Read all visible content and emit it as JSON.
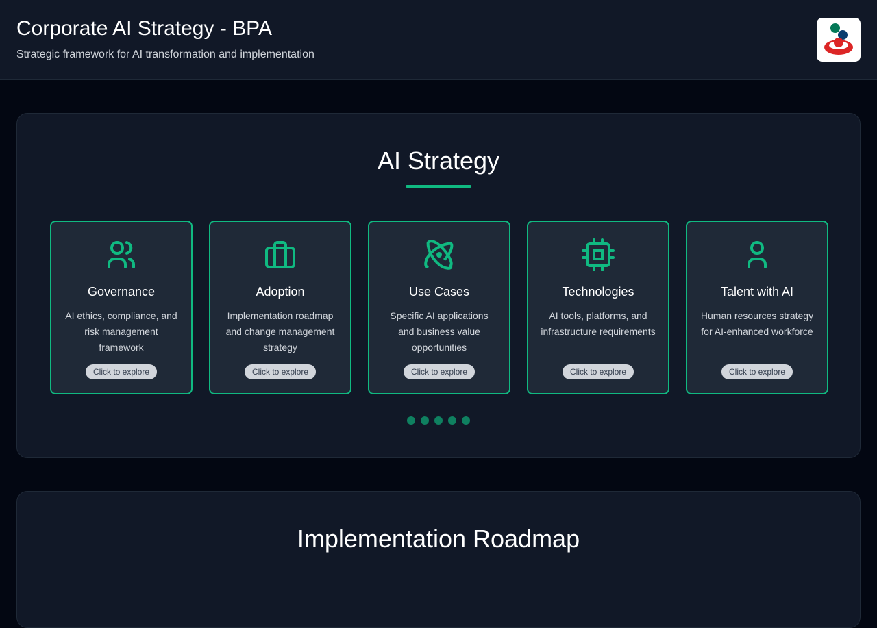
{
  "header": {
    "title": "Corporate AI Strategy - BPA",
    "subtitle": "Strategic framework for AI transformation and implementation"
  },
  "strategy": {
    "title": "AI Strategy",
    "cards": [
      {
        "icon": "users-icon",
        "title": "Governance",
        "desc": "AI ethics, compliance, and risk management framework",
        "button": "Click to explore"
      },
      {
        "icon": "briefcase-icon",
        "title": "Adoption",
        "desc": "Implementation roadmap and change management strategy",
        "button": "Click to explore"
      },
      {
        "icon": "atom-icon",
        "title": "Use Cases",
        "desc": "Specific AI applications and business value opportunities",
        "button": "Click to explore"
      },
      {
        "icon": "cpu-icon",
        "title": "Technologies",
        "desc": "AI tools, platforms, and infrastructure requirements",
        "button": "Click to explore"
      },
      {
        "icon": "user-icon",
        "title": "Talent with AI",
        "desc": "Human resources strategy for AI-enhanced workforce",
        "button": "Click to explore"
      }
    ],
    "dots": 5
  },
  "roadmap": {
    "title": "Implementation Roadmap"
  },
  "colors": {
    "accent": "#10b981",
    "bg": "#030712",
    "panel": "#111827",
    "card": "#1f2937"
  }
}
